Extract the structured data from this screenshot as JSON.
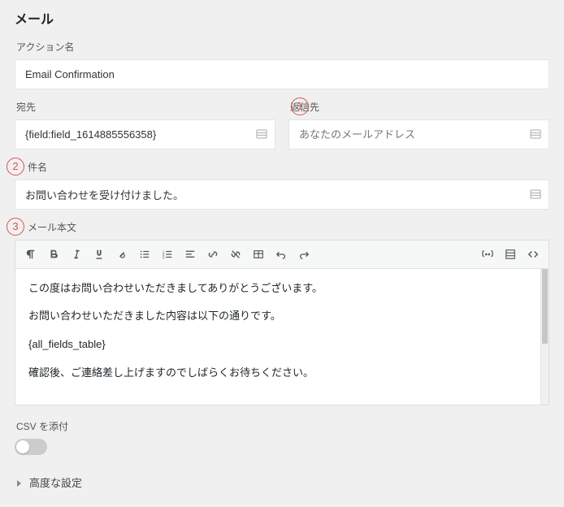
{
  "title": "メール",
  "action_name": {
    "label": "アクション名",
    "value": "Email Confirmation"
  },
  "to": {
    "label": "宛先",
    "value": "{field:field_1614885556358}"
  },
  "reply_to": {
    "label": "返信先",
    "placeholder": "あなたのメールアドレス"
  },
  "subject": {
    "label": "件名",
    "value": "お問い合わせを受け付けました。"
  },
  "body": {
    "label": "メール本文",
    "lines": [
      "この度はお問い合わせいただきましてありがとうございます。",
      "お問い合わせいただきました内容は以下の通りです。",
      "{all_fields_table}",
      "確認後、ご連絡差し上げますのでしばらくお待ちください。"
    ]
  },
  "csv": {
    "label": "CSV を添付",
    "on": false
  },
  "advanced": {
    "label": "高度な設定"
  },
  "annotations": {
    "a1": "1",
    "a2": "2",
    "a3": "3"
  },
  "toolbar_icons": [
    "paragraph",
    "bold",
    "italic",
    "underline",
    "clear",
    "list-ul",
    "list-ol",
    "align",
    "link",
    "unlink",
    "table",
    "undo",
    "redo"
  ],
  "toolbar_right_icons": [
    "merge-tag",
    "visual",
    "code"
  ]
}
